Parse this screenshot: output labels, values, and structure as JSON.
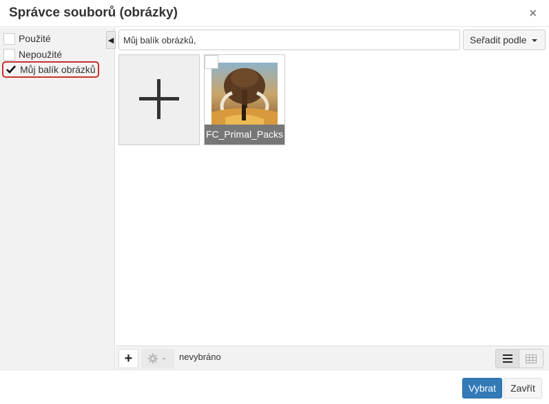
{
  "dialog": {
    "title": "Správce souborů (obrázky)",
    "close_symbol": "×"
  },
  "sidebar": {
    "items": [
      {
        "label": "Použité",
        "checked": false
      },
      {
        "label": "Nepoužité",
        "checked": false
      },
      {
        "label": "Můj balík obrázků",
        "checked": true
      }
    ],
    "collapse_symbol": "◀"
  },
  "toolbar": {
    "folder_path": "Můj balík obrázků,",
    "sort_label": "Seřadit podle"
  },
  "files": [
    {
      "name": "FC_Primal_Packs",
      "thumbnail": "mammoth-image-icon",
      "selected": false
    }
  ],
  "add_tile_icon": "plus-icon",
  "bottom_bar": {
    "add_symbol": "+",
    "status": "nevybráno",
    "view_modes": [
      "list-view-icon",
      "grid-view-icon"
    ],
    "active_view": "list"
  },
  "footer": {
    "select_label": "Vybrat",
    "close_label": "Zavřít"
  },
  "colors": {
    "primary": "#337ab7",
    "highlight_border": "#c9302c",
    "caption_bg": "#777777"
  }
}
